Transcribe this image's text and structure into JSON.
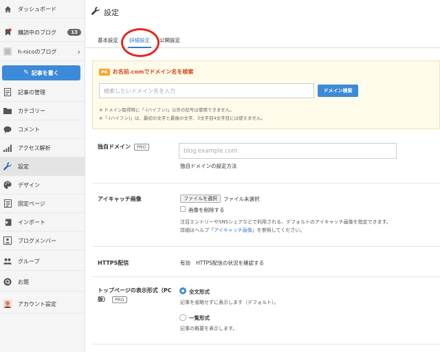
{
  "sidebar": {
    "items": [
      {
        "label": "ダッシュボード",
        "icon": "home-icon"
      },
      {
        "label": "購読中のブログ",
        "icon": "bookmark-icon",
        "badge": "13"
      },
      {
        "label": "h-nicoのブログ",
        "icon": "blog-avatar-icon"
      },
      {
        "label": "記事の管理",
        "icon": "document-icon"
      },
      {
        "label": "カテゴリー",
        "icon": "folder-icon"
      },
      {
        "label": "コメント",
        "icon": "comment-icon"
      },
      {
        "label": "アクセス解析",
        "icon": "bar-chart-icon"
      },
      {
        "label": "設定",
        "icon": "wrench-icon",
        "active": true
      },
      {
        "label": "デザイン",
        "icon": "palette-icon"
      },
      {
        "label": "固定ページ",
        "icon": "page-icon"
      },
      {
        "label": "インポート",
        "icon": "import-icon"
      },
      {
        "label": "ブログメンバー",
        "icon": "members-icon"
      },
      {
        "label": "グループ",
        "icon": "group-icon"
      },
      {
        "label": "お題",
        "icon": "topic-icon"
      },
      {
        "label": "アカウント設定",
        "icon": "account-avatar-icon"
      }
    ],
    "write_button": "記事を書く"
  },
  "header": {
    "title": "設定"
  },
  "tabs": [
    {
      "label": "基本設定"
    },
    {
      "label": "詳細設定",
      "active": true
    },
    {
      "label": "公開設定"
    }
  ],
  "domain_promo": {
    "pr": "PR",
    "title": "お名前.comでドメイン名を検索",
    "placeholder": "検索したいドメイン名を入力",
    "button": "ドメイン検索",
    "note1": "※ ドメイン取得時に「-(ハイフン)」以外の記号は使用できません。",
    "note2": "※「-(ハイフン)」は、最初の文字と最後の文字、3文字目4文字目には使えません。"
  },
  "custom_domain": {
    "label": "独自ドメイン",
    "pro": "PRO",
    "placeholder": "blog.example.com",
    "link": "独自ドメインの設定方法"
  },
  "eyecatch": {
    "label": "アイキャッチ画像",
    "file_button": "ファイルを選択",
    "file_status": "ファイル未選択",
    "delete_label": "画像を削除する",
    "desc1": "注目エントリーやSNSシェアなどで利用される、デフォルトのアイキャッチ画像を指定できます。",
    "desc2_pre": "詳細はヘルプ「",
    "desc2_link": "アイキャッチ画像",
    "desc2_post": "」を参照してください。"
  },
  "https": {
    "label": "HTTPS配信",
    "status": "有効",
    "link": "HTTPS配信の状況を確認する"
  },
  "top_display": {
    "label_line1": "トップページの表示形式（PC",
    "label_line2": "版）",
    "pro": "PRO",
    "option1": "全文形式",
    "option1_desc": "記事を省略せずに表示します（デフォルト）。",
    "option2": "一覧形式",
    "option2_desc": "記事の概要を表示します。"
  },
  "colors": {
    "accent": "#3c8ad8",
    "highlight": "#e8241a"
  }
}
